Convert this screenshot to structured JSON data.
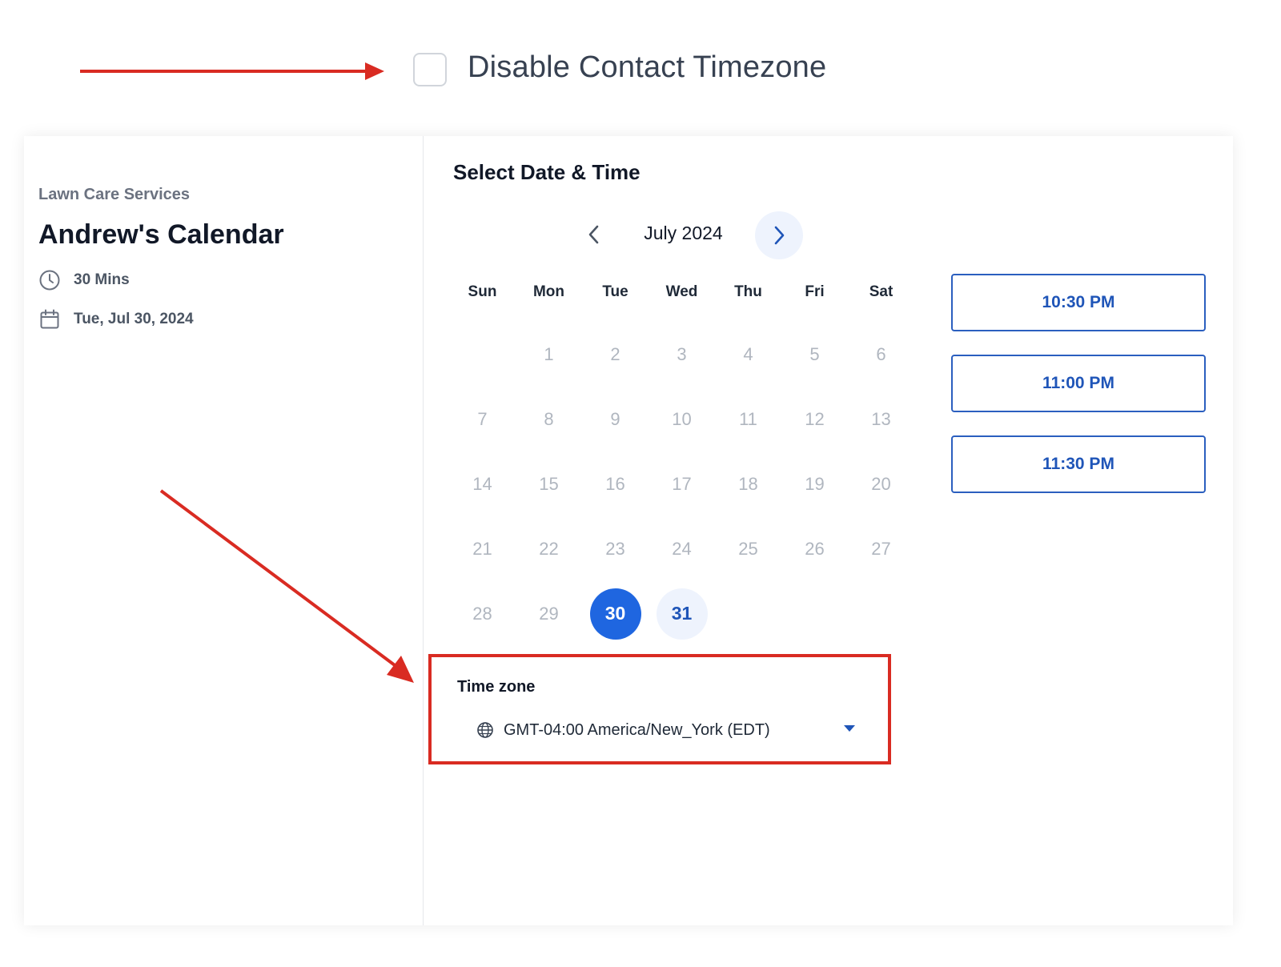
{
  "option": {
    "label": "Disable Contact Timezone",
    "checked": false
  },
  "sidebar": {
    "company": "Lawn Care Services",
    "calendar_title": "Andrew's Calendar",
    "duration": "30 Mins",
    "date": "Tue, Jul 30, 2024"
  },
  "picker": {
    "title": "Select Date & Time",
    "month": "July 2024",
    "weekdays": [
      "Sun",
      "Mon",
      "Tue",
      "Wed",
      "Thu",
      "Fri",
      "Sat"
    ],
    "days": [
      {
        "label": ""
      },
      {
        "label": "1"
      },
      {
        "label": "2"
      },
      {
        "label": "3"
      },
      {
        "label": "4"
      },
      {
        "label": "5"
      },
      {
        "label": "6"
      },
      {
        "label": "7"
      },
      {
        "label": "8"
      },
      {
        "label": "9"
      },
      {
        "label": "10"
      },
      {
        "label": "11"
      },
      {
        "label": "12"
      },
      {
        "label": "13"
      },
      {
        "label": "14"
      },
      {
        "label": "15"
      },
      {
        "label": "16"
      },
      {
        "label": "17"
      },
      {
        "label": "18"
      },
      {
        "label": "19"
      },
      {
        "label": "20"
      },
      {
        "label": "21"
      },
      {
        "label": "22"
      },
      {
        "label": "23"
      },
      {
        "label": "24"
      },
      {
        "label": "25"
      },
      {
        "label": "26"
      },
      {
        "label": "27"
      },
      {
        "label": "28"
      },
      {
        "label": "29"
      },
      {
        "label": "30",
        "state": "selected"
      },
      {
        "label": "31",
        "state": "available"
      }
    ],
    "timezone_label": "Time zone",
    "timezone_value": "GMT-04:00 America/New_York (EDT)"
  },
  "slots": [
    "10:30 PM",
    "11:00 PM",
    "11:30 PM"
  ],
  "colors": {
    "accent": "#1f66e0",
    "annotation_red": "#d92b22",
    "available_bg": "#eef3fd"
  },
  "icons": {
    "duration": "clock-icon",
    "date": "calendar-icon",
    "prev": "chevron-left-icon",
    "next": "chevron-right-icon",
    "timezone": "globe-icon",
    "dropdown": "caret-down-icon"
  }
}
